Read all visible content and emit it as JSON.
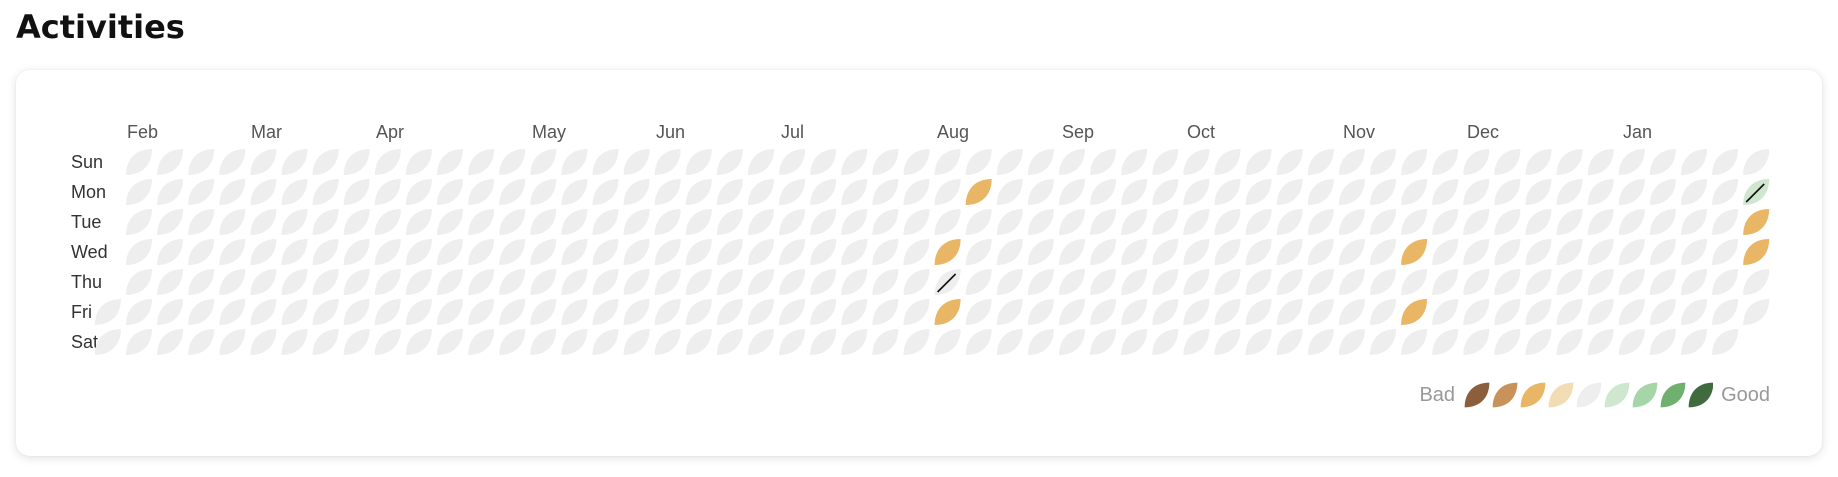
{
  "page": {
    "title": "Activities"
  },
  "months": [
    "Feb",
    "Mar",
    "Apr",
    "May",
    "Jun",
    "Jul",
    "Aug",
    "Sep",
    "Oct",
    "Nov",
    "Dec",
    "Jan"
  ],
  "days": [
    "Sun",
    "Mon",
    "Tue",
    "Wed",
    "Thu",
    "Fri",
    "Sat"
  ],
  "legend": {
    "bad_label": "Bad",
    "good_label": "Good",
    "levels": [
      "#8b5e3c",
      "#c9925a",
      "#e8b664",
      "#f2dcb4",
      "#eeeeee",
      "#cfe6cf",
      "#a6d6a8",
      "#6fb06f",
      "#3f6b3f"
    ]
  },
  "colors": {
    "empty": "#eeeeee",
    "stroke_mark": "#111111"
  },
  "activity_marks": [
    {
      "week": 28,
      "day": "Mon",
      "color": "#e8b664"
    },
    {
      "week": 27,
      "day": "Wed",
      "color": "#e8b664"
    },
    {
      "week": 27,
      "day": "Thu",
      "mark": "slash"
    },
    {
      "week": 27,
      "day": "Fri",
      "color": "#e8b664"
    },
    {
      "week": 42,
      "day": "Wed",
      "color": "#e8b664"
    },
    {
      "week": 42,
      "day": "Fri",
      "color": "#e8b664"
    },
    {
      "week": 53,
      "day": "Mon",
      "color": "#cfe6cf",
      "mark": "slash"
    },
    {
      "week": 53,
      "day": "Tue",
      "color": "#e8b664"
    },
    {
      "week": 53,
      "day": "Wed",
      "color": "#e8b664"
    }
  ]
}
